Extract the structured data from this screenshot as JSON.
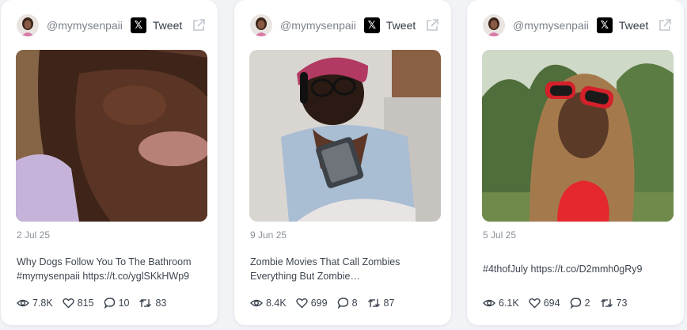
{
  "cards": [
    {
      "handle": "@mymysenpaii",
      "x_glyph": "𝕏",
      "tweet_label": "Tweet",
      "date": "2 Jul 25",
      "text_lines": [
        "Why Dogs Follow You To The Bathroom",
        "#mymysenpaii https://t.co/yglSKkHWp9"
      ],
      "views": "7.8K",
      "likes": "815",
      "replies": "10",
      "retweets": "83",
      "media_description_icon": "video-thumbnail-closeup-face"
    },
    {
      "handle": "@mymysenpaii",
      "x_glyph": "𝕏",
      "tweet_label": "Tweet",
      "date": "9 Jun 25",
      "text_lines": [
        "Zombie Movies That Call Zombies",
        "Everything But Zombie…"
      ],
      "views": "8.4K",
      "likes": "699",
      "replies": "8",
      "retweets": "87",
      "media_description_icon": "video-thumbnail-headphones-tablet"
    },
    {
      "handle": "@mymysenpaii",
      "x_glyph": "𝕏",
      "tweet_label": "Tweet",
      "date": "5 Jul 25",
      "text_lines": [
        "#4thofJuly https://t.co/D2mmh0gRy9"
      ],
      "views": "6.1K",
      "likes": "694",
      "replies": "2",
      "retweets": "73",
      "media_description_icon": "video-thumbnail-red-sunglasses"
    }
  ],
  "colors": {
    "page_bg": "#f1f3f6",
    "card_bg": "#ffffff",
    "muted_text": "#7b828c",
    "body_text": "#3d4550"
  }
}
